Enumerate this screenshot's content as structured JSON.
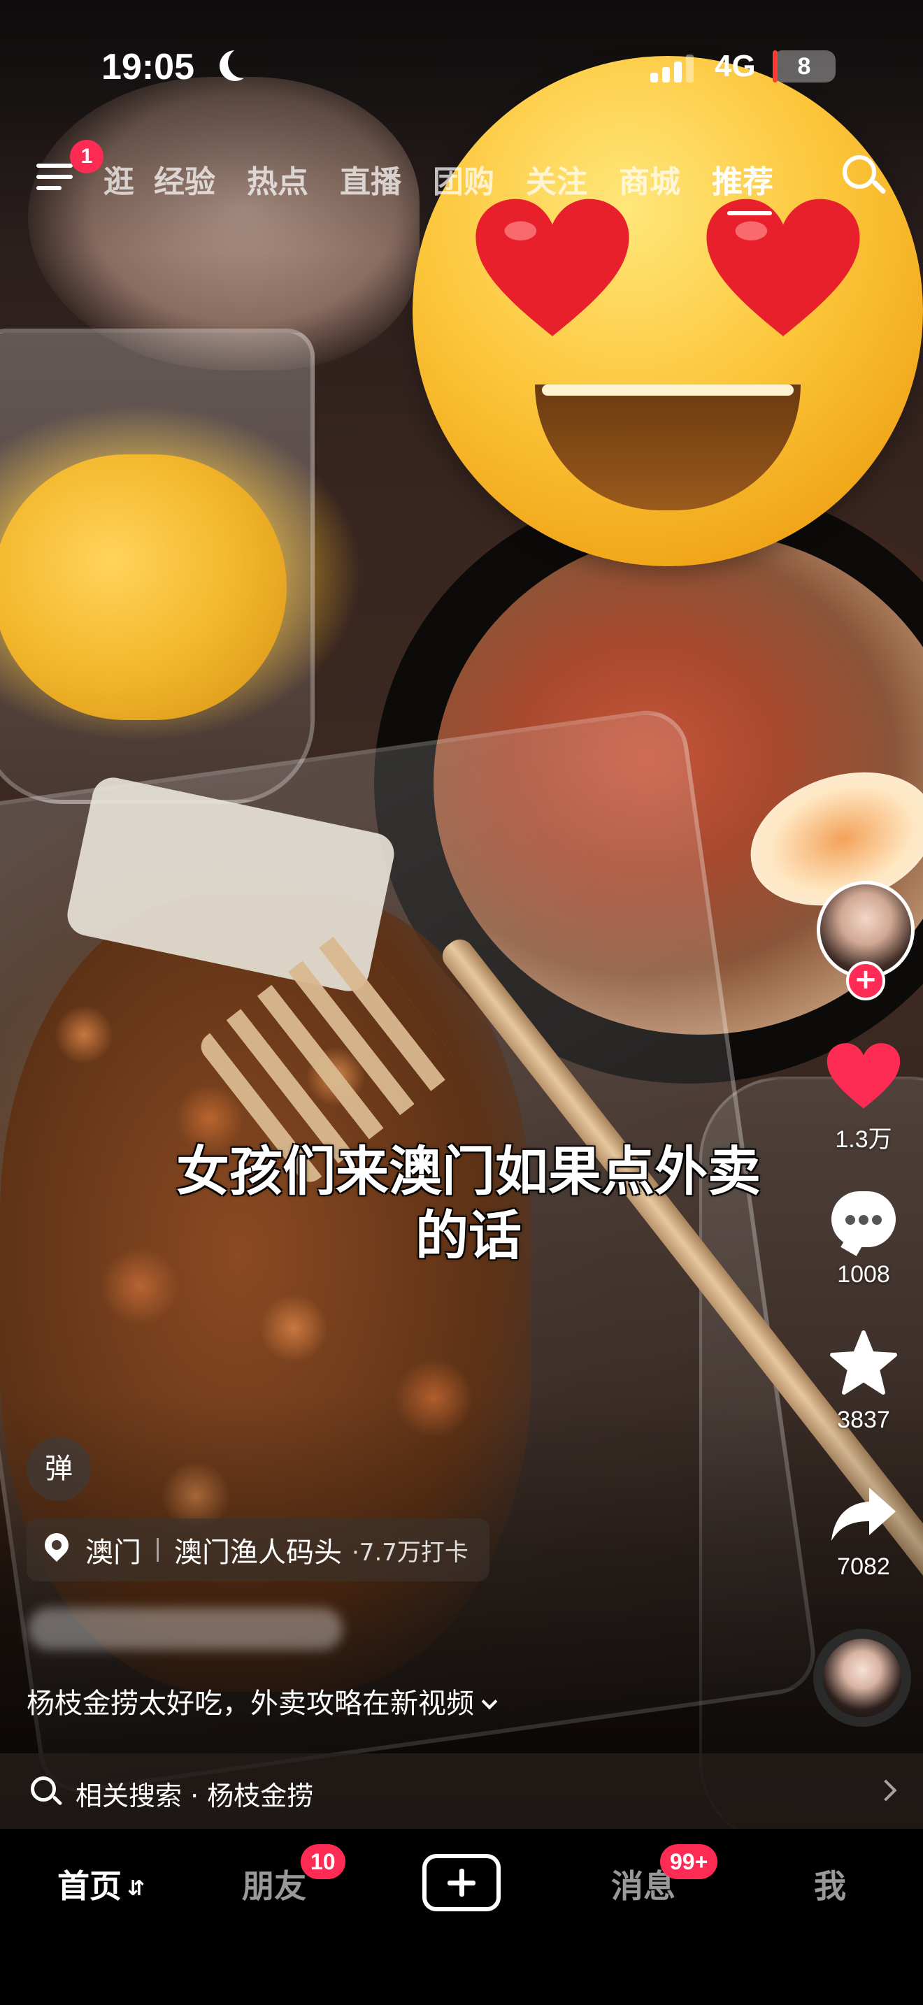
{
  "status_bar": {
    "time": "19:05",
    "network": "4G",
    "battery": "8",
    "battery_fraction": 0.08,
    "colors": {
      "battery_low": "#ff3b30"
    }
  },
  "top_nav": {
    "menu_badge": "1",
    "partial_tab": "逛",
    "tabs": [
      "经验",
      "热点",
      "直播",
      "团购",
      "关注",
      "商城",
      "推荐"
    ],
    "active_tab": "推荐"
  },
  "video": {
    "overlay_caption_line1": "女孩们来澳门如果点外卖",
    "overlay_caption_line2": "的话",
    "sticker": "heart-eyes-emoji"
  },
  "actions": {
    "follow": "+",
    "likes": "1.3万",
    "comments": "1008",
    "favorites": "3837",
    "shares": "7082",
    "colors": {
      "like": "#fe2c55"
    }
  },
  "info": {
    "danmaku": "弹",
    "location_city": "澳门",
    "location_place": "澳门渔人码头",
    "location_checkins": "·7.7万打卡",
    "description": "杨枝金捞太好吃，外卖攻略在新视频"
  },
  "related_search": {
    "label": "相关搜索 · 杨枝金捞"
  },
  "tab_bar": {
    "home": "首页",
    "friends": "朋友",
    "friends_badge": "10",
    "messages": "消息",
    "messages_badge": "99+",
    "me": "我",
    "colors": {
      "badge": "#fe2c55"
    }
  }
}
